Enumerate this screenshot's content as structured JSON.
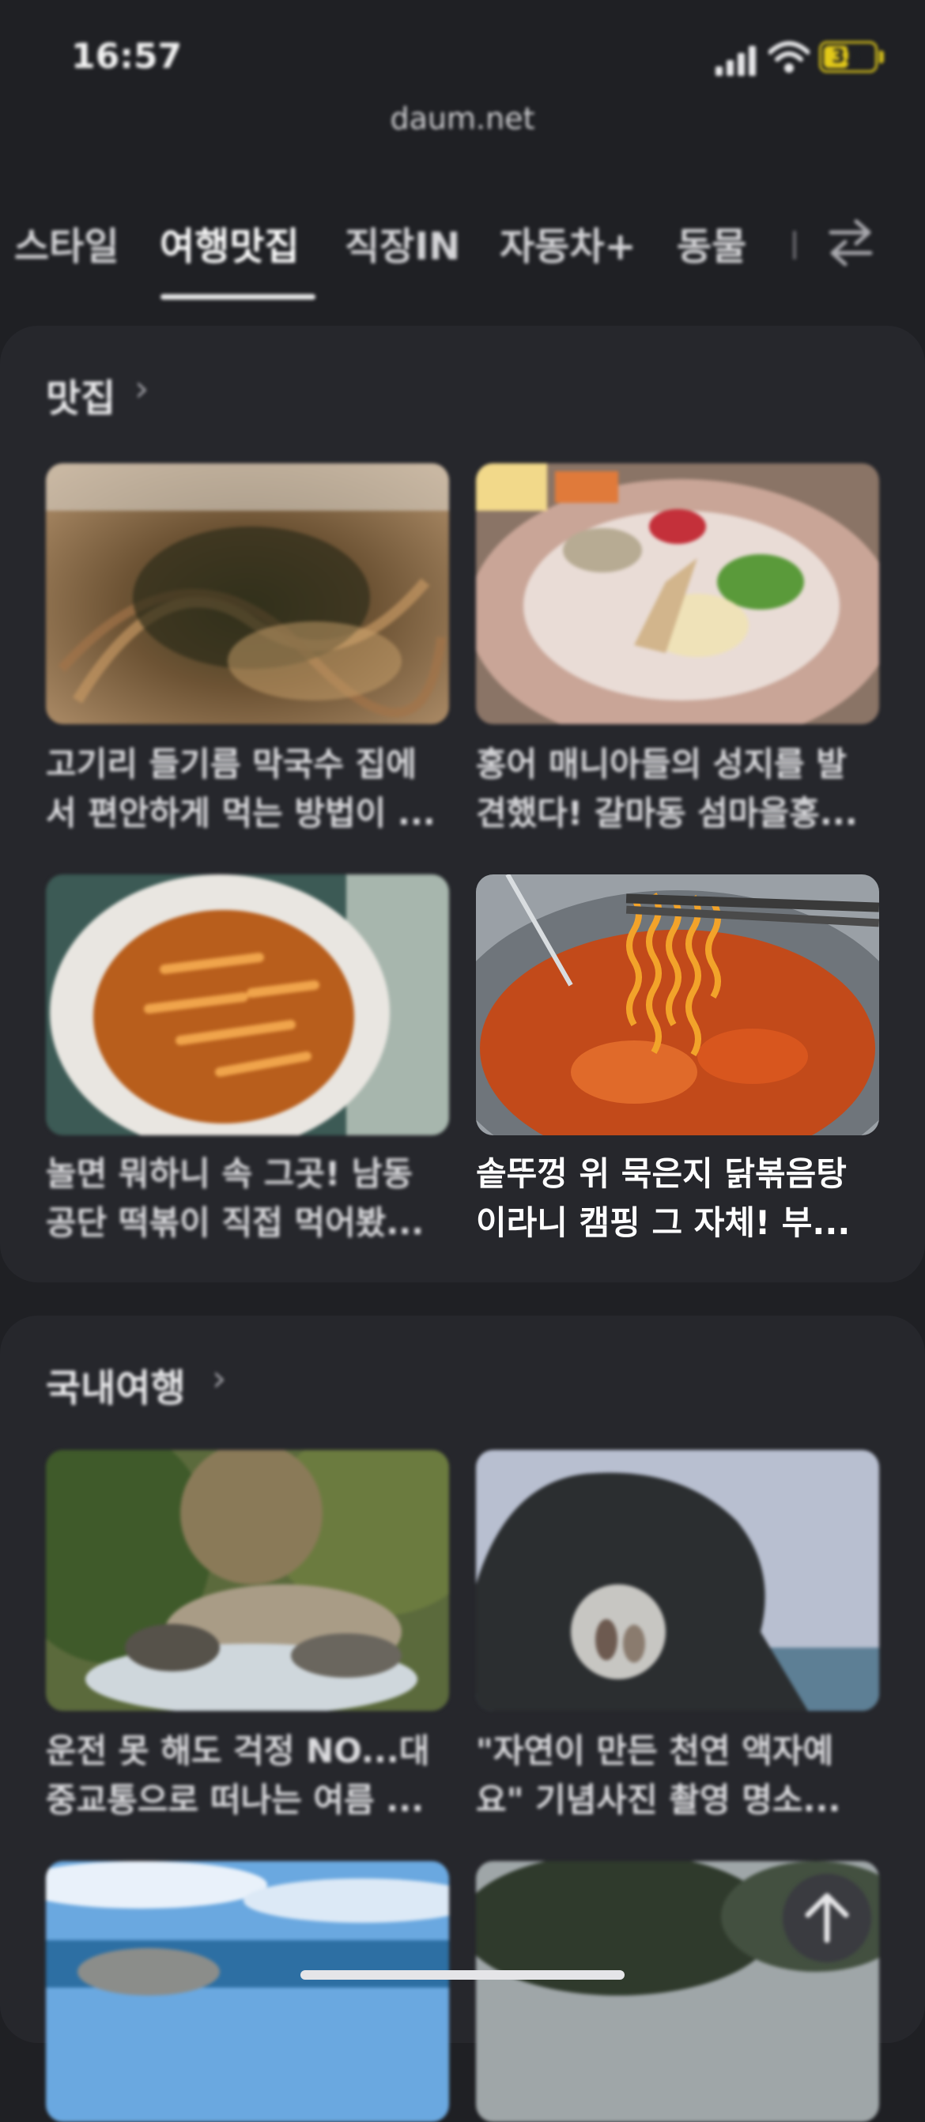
{
  "status_bar": {
    "time": "16:57",
    "battery": "33"
  },
  "browser": {
    "url": "daum.net"
  },
  "tabs": [
    {
      "label": "스타일"
    },
    {
      "label": "여행맛집"
    },
    {
      "label": "직장IN"
    },
    {
      "label": "자동차+"
    },
    {
      "label": "동물"
    }
  ],
  "sections": [
    {
      "title": "맛집",
      "items": [
        {
          "line1": "고기리 들기름 막국수 집에",
          "line2": "서 편안하게 먹는 방법이 ..."
        },
        {
          "line1": "홍어 매니아들의 성지를 발",
          "line2": "견했다! 갈마동 섬마을홍..."
        },
        {
          "line1": "놀면 뭐하니 속 그곳! 남동",
          "line2": "공단 떡볶이 직접 먹어봤..."
        },
        {
          "line1": "솥뚜껑 위 묵은지 닭볶음탕",
          "line2": "이라니 캠핑 그 자체! 부..."
        }
      ]
    },
    {
      "title": "국내여행",
      "items": [
        {
          "line1": "운전 못 해도 걱정 NO...대",
          "line2": "중교통으로 떠나는 여름 ..."
        },
        {
          "line1": "\"자연이 만든 천연 액자예",
          "line2": "요\" 기념사진 촬영 명소..."
        }
      ]
    }
  ],
  "colors": {
    "background": "#1f2024",
    "card": "#26272c",
    "battery": "#e2c919"
  }
}
